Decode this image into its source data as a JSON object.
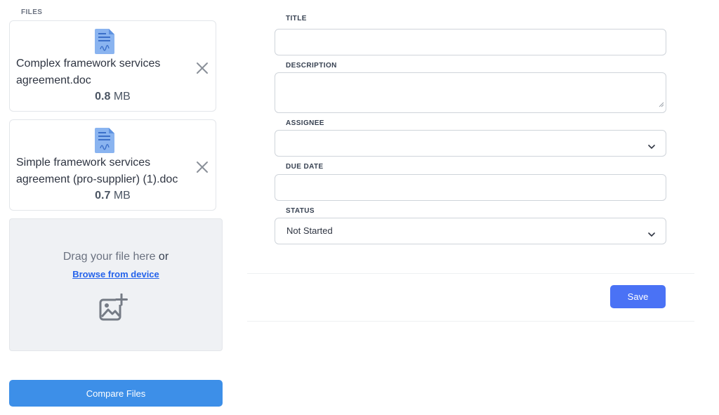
{
  "files_panel": {
    "label": "FILES",
    "files": [
      {
        "name": "Complex framework services agreement.doc",
        "size_value": "0.8",
        "size_unit": "MB"
      },
      {
        "name": "Simple framework services agreement (pro-supplier) (1).doc",
        "size_value": "0.7",
        "size_unit": "MB"
      }
    ],
    "dropzone": {
      "text": "Drag your file here",
      "or_text": "or",
      "browse_label": "Browse from device"
    },
    "compare_label": "Compare Files"
  },
  "form": {
    "title_label": "TITLE",
    "title_value": "",
    "description_label": "DESCRIPTION",
    "description_value": "",
    "assignee_label": "ASSIGNEE",
    "assignee_value": "",
    "due_date_label": "DUE DATE",
    "due_date_value": "",
    "status_label": "STATUS",
    "status_value": "Not Started",
    "save_label": "Save"
  },
  "icons": {
    "file": "document-icon",
    "remove": "close-icon",
    "dropzone": "add-image-icon",
    "select": "chevron-down-icon"
  },
  "colors": {
    "primary_button": "#3d8fe8",
    "save_button": "#4a72f5",
    "link": "#2563eb",
    "dropzone_bg": "#eff1f4"
  }
}
